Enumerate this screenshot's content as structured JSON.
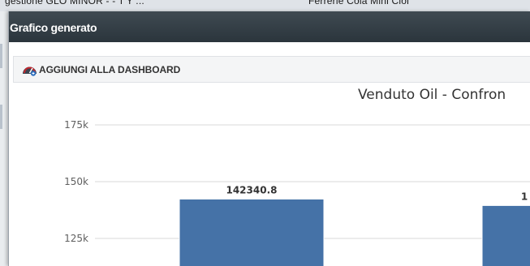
{
  "background_page": {
    "text_left": "gestione GLO MINOR - - T'Y ...",
    "text_right": "Ferrerie   Cola Mini Ciol"
  },
  "modal": {
    "title": "Grafico generato",
    "add_to_dashboard_label": "AGGIUNGI ALLA DASHBOARD"
  },
  "colors": {
    "header": "#2f3a41",
    "bar": "#4572a7",
    "grid": "#d8d8d8"
  },
  "chart_data": {
    "type": "bar",
    "title": "Venduto Oil - Confron",
    "ylim": [
      100000,
      175000
    ],
    "y_ticks": [
      {
        "value": 175000,
        "label": "175k"
      },
      {
        "value": 150000,
        "label": "150k"
      },
      {
        "value": 125000,
        "label": "125k"
      }
    ],
    "series": [
      {
        "values": [
          142340.8,
          139500
        ],
        "labels": [
          "142340.8",
          "1"
        ]
      }
    ],
    "grid": true,
    "legend": "none"
  }
}
